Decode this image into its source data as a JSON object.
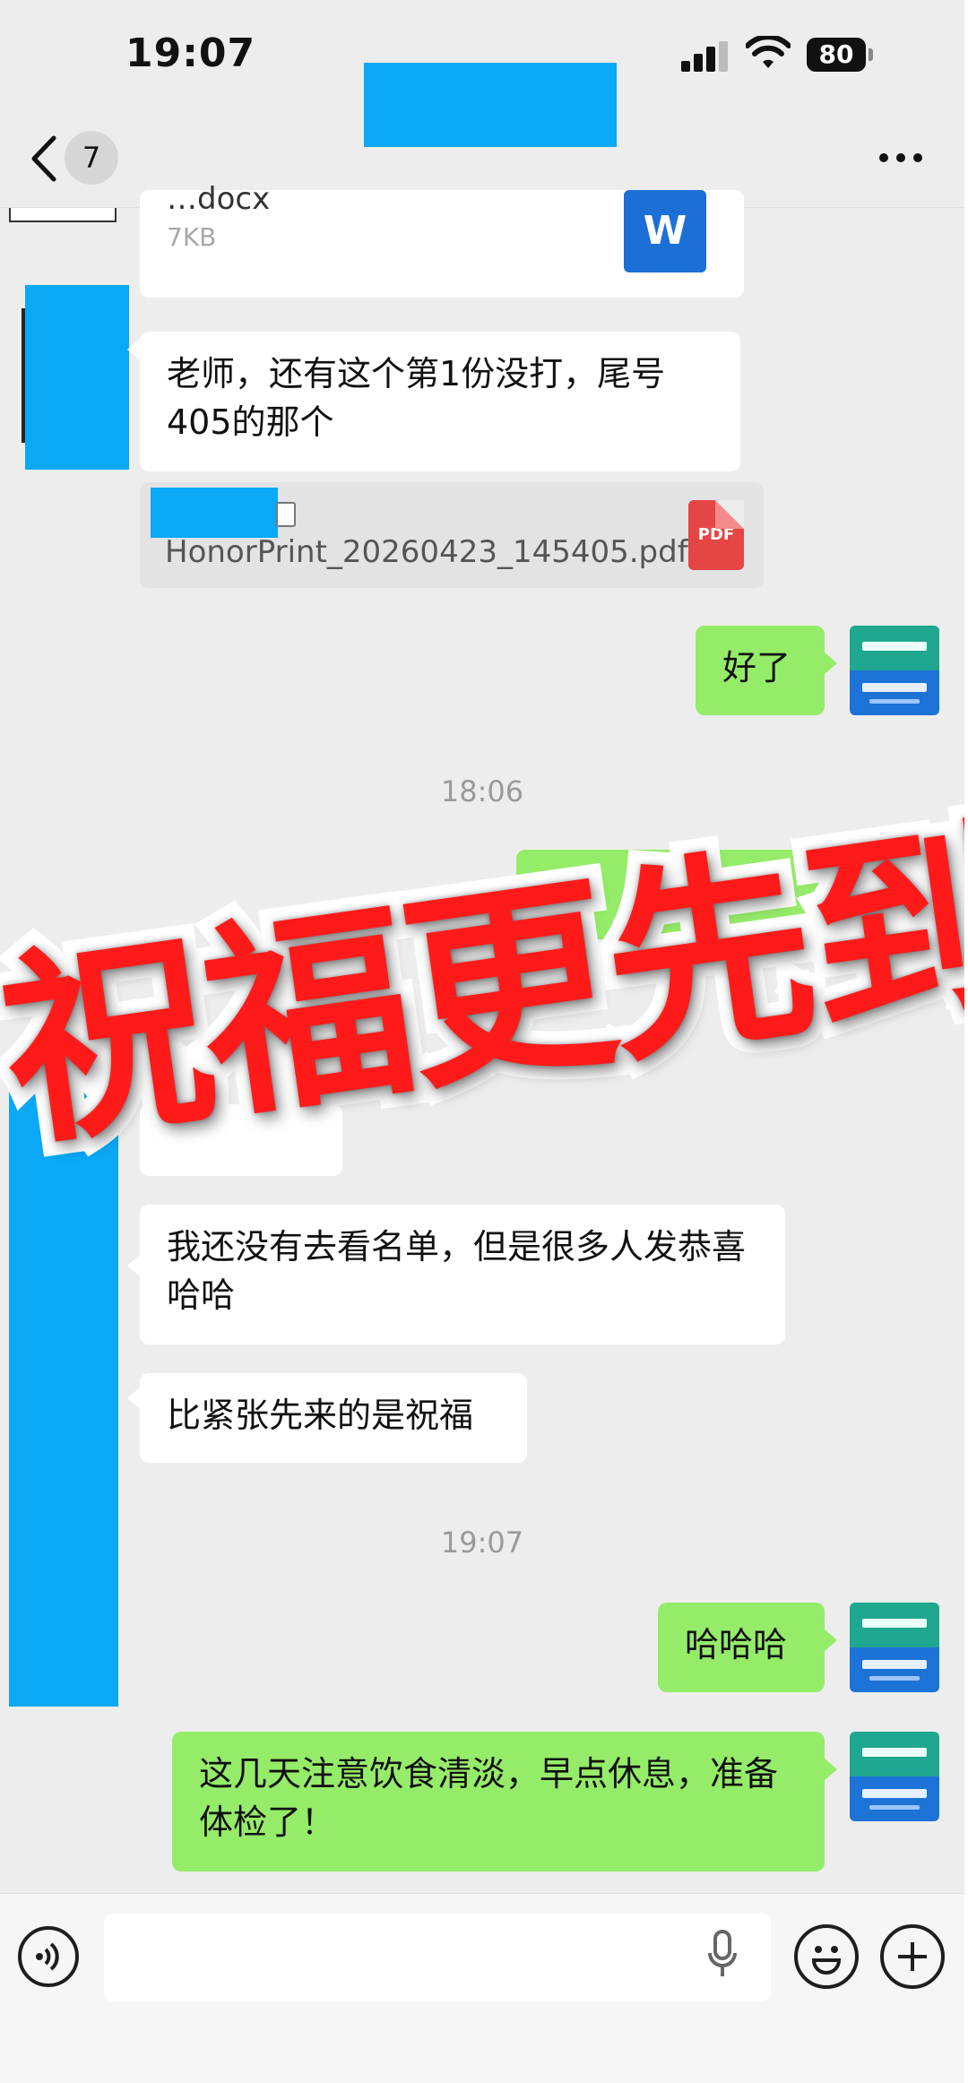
{
  "status_bar": {
    "time": "19:07",
    "battery": "80"
  },
  "nav": {
    "unread_count": "7",
    "title": "",
    "back_icon": "chevron-left-icon",
    "more_icon": "more-dots-icon"
  },
  "messages": {
    "file1": {
      "name": "…docx",
      "size": "7KB",
      "type_label": "W"
    },
    "m1": "老师，还有这个第1份没打，尾号405的那个",
    "file2": {
      "name": "HonorPrint_20260423_145405.pdf",
      "type_label": "PDF"
    },
    "m2": "好了",
    "time1": "18:06",
    "m3": "我还没有去看名单，但是很多人发恭喜哈哈",
    "m4": "比紧张先来的是祝福",
    "time2": "19:07",
    "m5": "哈哈哈",
    "m6": "这几天注意饮食清淡，早点休息，准备体检了！"
  },
  "overlay": {
    "text": "祝福更先到"
  },
  "colors": {
    "chat_bg": "#ededed",
    "bubble_green": "#95ec69",
    "redaction": "#0aa8f5",
    "overlay_red": "#ff1a1a"
  }
}
